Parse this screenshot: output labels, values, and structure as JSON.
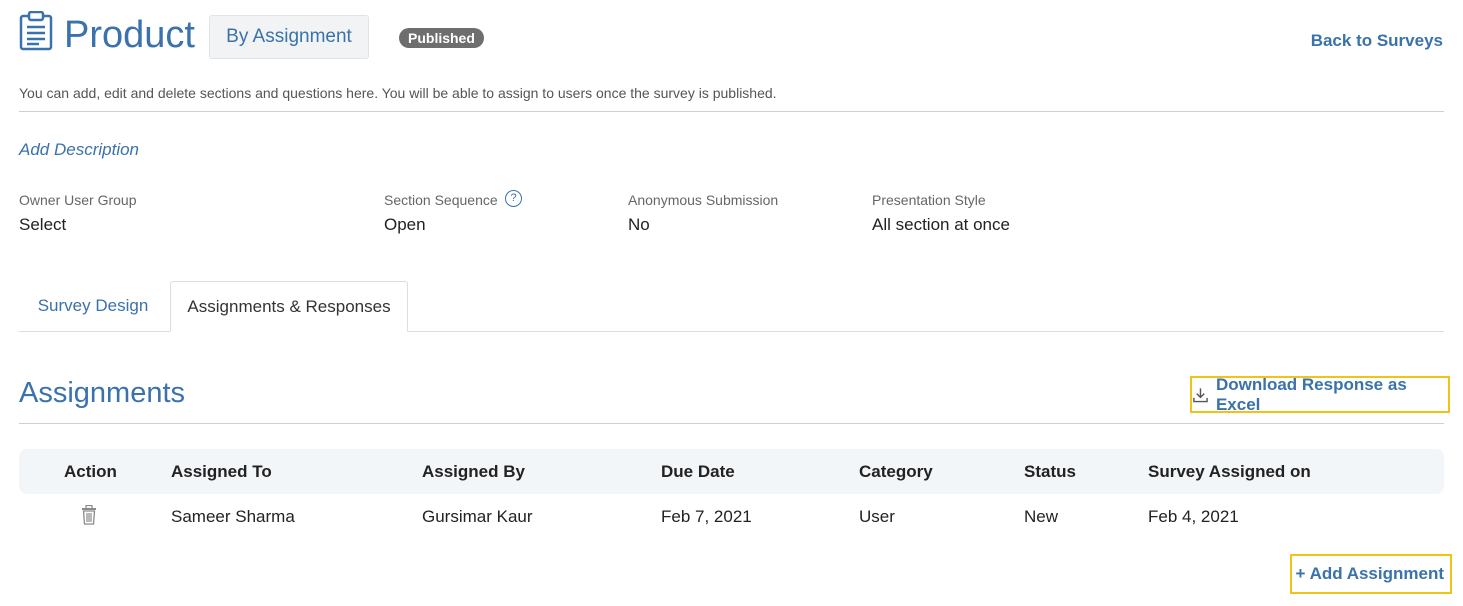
{
  "header": {
    "title": "Product",
    "assignment_button": "By Assignment",
    "status_badge": "Published",
    "back_link": "Back to Surveys",
    "icon": "clipboard-icon"
  },
  "helper_text": "You can add, edit and delete sections and questions here. You will be able to assign to users once the survey is published.",
  "add_description": "Add Description",
  "meta": [
    {
      "label": "Owner User Group",
      "value": "Select"
    },
    {
      "label": "Section Sequence",
      "value": "Open",
      "help_icon": "?"
    },
    {
      "label": "Anonymous Submission",
      "value": "No"
    },
    {
      "label": "Presentation Style",
      "value": "All section at once"
    }
  ],
  "tabs": [
    {
      "label": "Survey Design",
      "active": false
    },
    {
      "label": "Assignments & Responses",
      "active": true
    }
  ],
  "assignments": {
    "title": "Assignments",
    "download_label": "Download Response as Excel",
    "download_icon": "download-icon",
    "columns": [
      "Action",
      "Assigned To",
      "Assigned By",
      "Due Date",
      "Category",
      "Status",
      "Survey Assigned on"
    ],
    "rows": [
      {
        "assigned_to": "Sameer Sharma",
        "assigned_by": "Gursimar Kaur",
        "due_date": "Feb 7, 2021",
        "category": "User",
        "status": "New",
        "assigned_on": "Feb 4, 2021",
        "action_icon": "trash-icon"
      }
    ],
    "add_label": "+ Add Assignment"
  },
  "colors": {
    "accent": "#3a72ab",
    "highlight": "#f2c317",
    "badge": "#6e6e6e"
  }
}
